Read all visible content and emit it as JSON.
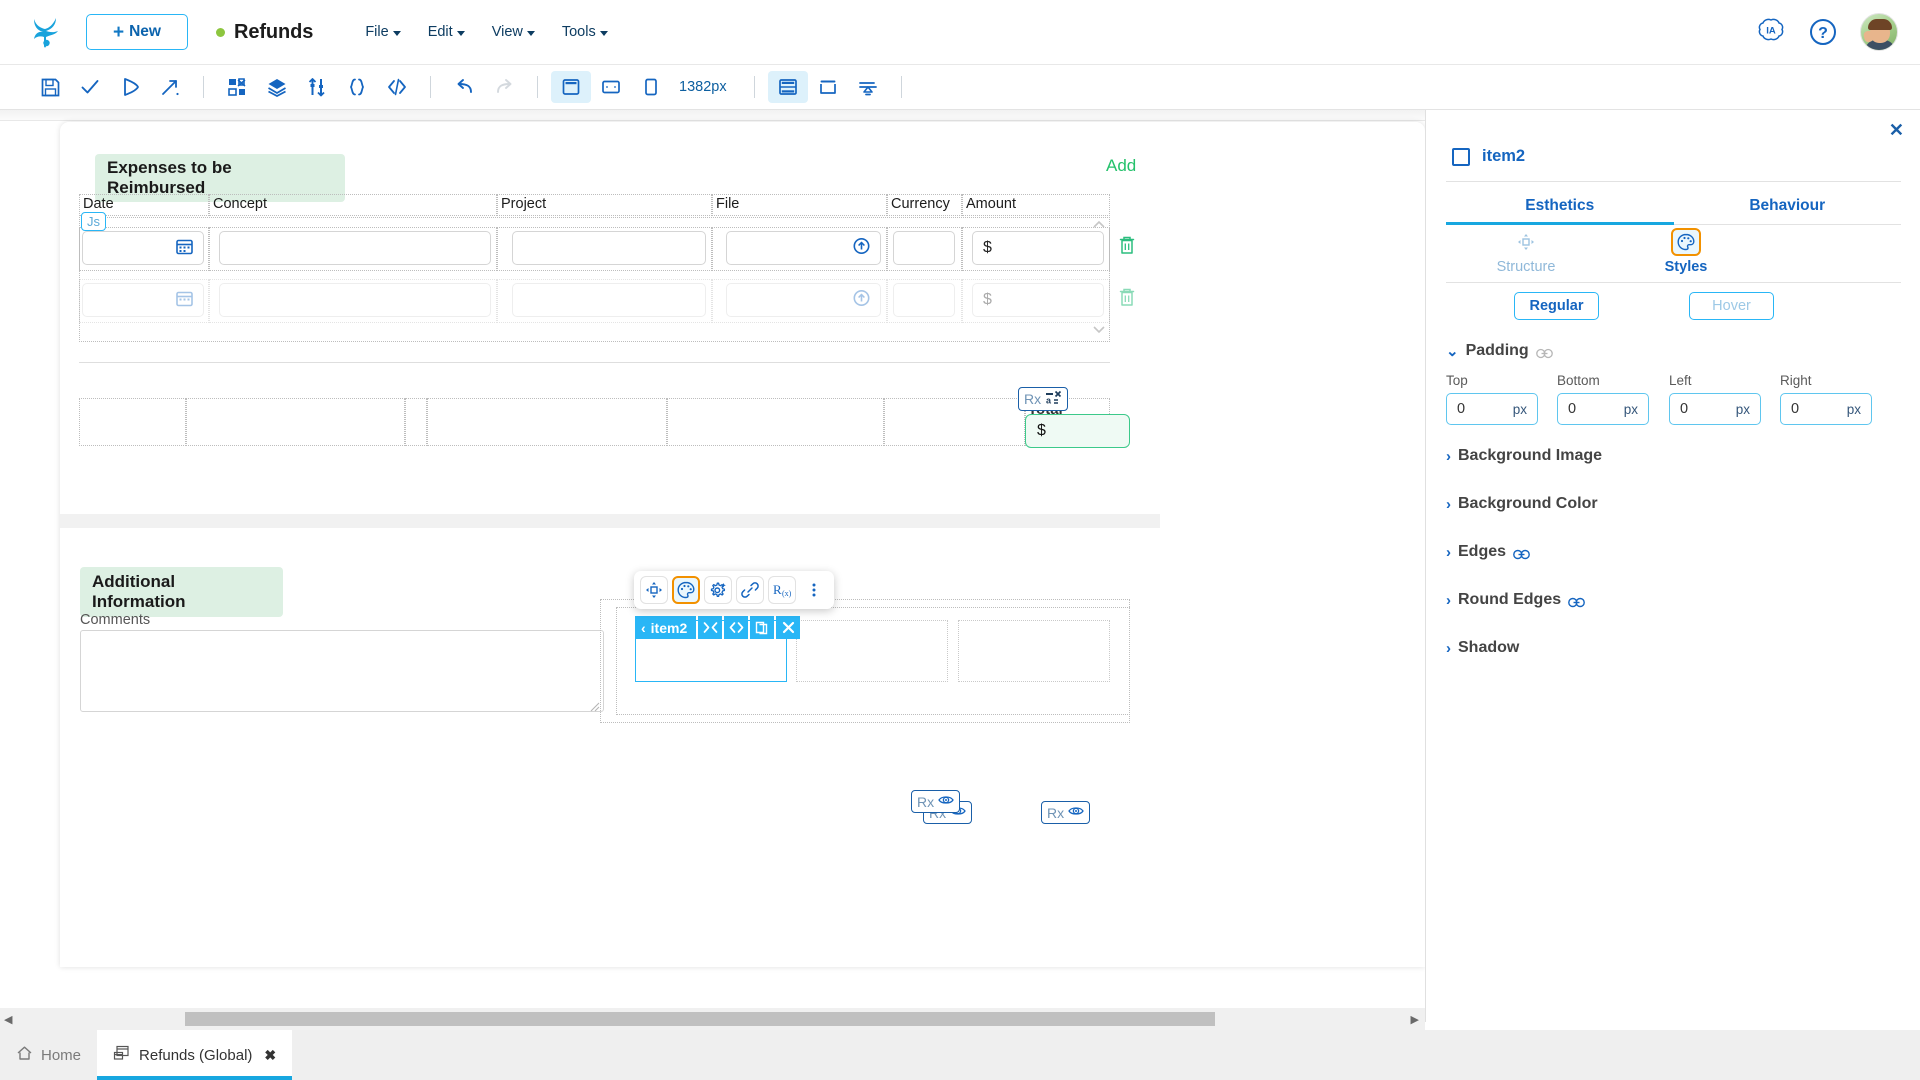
{
  "header": {
    "logo_icon": "frog-logo-icon",
    "new_button": "New",
    "app_title": "Refunds",
    "status_dot_color": "#8dc63f",
    "menus": [
      "File",
      "Edit",
      "View",
      "Tools"
    ],
    "right_icons": [
      {
        "name": "ia-assistant-icon",
        "label": "IA"
      },
      {
        "name": "help-icon",
        "label": "?"
      },
      {
        "name": "user-avatar",
        "label": ""
      }
    ]
  },
  "toolbar": {
    "viewport_size": "1382px",
    "groups": [
      [
        {
          "name": "save-icon",
          "active": false
        },
        {
          "name": "validate-check-icon",
          "active": false
        },
        {
          "name": "run-play-icon",
          "active": false
        },
        {
          "name": "deploy-share-icon",
          "active": false
        }
      ],
      [
        {
          "name": "components-grid-icon",
          "active": false
        },
        {
          "name": "layers-stack-icon",
          "active": false
        },
        {
          "name": "data-model-icon",
          "active": false
        },
        {
          "name": "variables-braces-icon",
          "active": false
        },
        {
          "name": "code-brackets-icon",
          "active": false
        }
      ],
      [
        {
          "name": "undo-icon",
          "active": false
        },
        {
          "name": "redo-icon",
          "active": false,
          "disabled": true
        }
      ],
      [
        {
          "name": "desktop-view-icon",
          "active": true
        },
        {
          "name": "tablet-view-icon",
          "active": false
        },
        {
          "name": "mobile-view-icon",
          "active": false
        }
      ],
      [
        {
          "name": "grid-layout-icon",
          "active": false
        },
        {
          "name": "container-icon",
          "active": false
        },
        {
          "name": "align-icon",
          "active": false
        }
      ]
    ]
  },
  "canvas": {
    "expenses": {
      "title": "Expenses to be Reimbursed",
      "add_link": "Add",
      "columns": [
        "Date",
        "Concept",
        "Project",
        "File",
        "Currency",
        "Amount"
      ],
      "js_badge": "Js",
      "rows": [
        {
          "date": "",
          "concept": "",
          "project": "",
          "file": "",
          "currency": "",
          "amount_symbol": "$",
          "date_icon": "calendar-icon",
          "file_icon": "upload-circle-icon",
          "delete_icon": "trash-icon",
          "faded": false
        },
        {
          "date": "",
          "concept": "",
          "project": "",
          "file": "",
          "currency": "",
          "amount_symbol": "$",
          "date_icon": "calendar-icon",
          "file_icon": "upload-circle-icon",
          "delete_icon": "trash-icon",
          "faded": true
        }
      ]
    },
    "totals": {
      "label": "Total",
      "value_symbol": "$",
      "rx_badge": {
        "label": "Rx",
        "icon": "formula-abc-icon"
      }
    },
    "additional": {
      "title": "Additional Information",
      "comments_label": "Comments",
      "comments_value": ""
    },
    "selection": {
      "element_name": "item2",
      "back_chevron": "‹",
      "chips": [
        {
          "name": "collapse-expand-icon",
          "glyph": "><"
        },
        {
          "name": "code-view-icon",
          "glyph": "<>"
        },
        {
          "name": "duplicate-icon",
          "glyph": "copy"
        },
        {
          "name": "close-selection-icon",
          "glyph": "✕"
        }
      ]
    },
    "float_toolbar": [
      {
        "name": "move-structure-icon",
        "highlighted": false
      },
      {
        "name": "styles-palette-icon",
        "highlighted": true
      },
      {
        "name": "settings-gear-icon",
        "highlighted": false
      },
      {
        "name": "link-chain-icon",
        "highlighted": false
      },
      {
        "name": "formula-rx-icon",
        "highlighted": false
      },
      {
        "name": "more-options-icon",
        "highlighted": false
      }
    ],
    "rx_badges": [
      {
        "label": "Rx",
        "icon": "eye-visibility-icon"
      },
      {
        "label": "Rx",
        "icon": "eye-visibility-icon"
      },
      {
        "label": "Rx",
        "icon": "eye-visibility-icon"
      }
    ]
  },
  "panel": {
    "close_icon": "close-icon",
    "element_name": "item2",
    "tabs": [
      {
        "label": "Esthetics",
        "active": true
      },
      {
        "label": "Behaviour",
        "active": false
      }
    ],
    "sub_tabs": [
      {
        "label": "Structure",
        "icon": "move-structure-icon",
        "active": false
      },
      {
        "label": "Styles",
        "icon": "styles-palette-icon",
        "active": true
      }
    ],
    "state_buttons": [
      {
        "label": "Regular",
        "active": true
      },
      {
        "label": "Hover",
        "active": false
      }
    ],
    "padding": {
      "title": "Padding",
      "linked_icon": "link-chain-icon",
      "expanded": true,
      "fields": [
        {
          "label": "Top",
          "value": "0",
          "unit": "px"
        },
        {
          "label": "Bottom",
          "value": "0",
          "unit": "px"
        },
        {
          "label": "Left",
          "value": "0",
          "unit": "px"
        },
        {
          "label": "Right",
          "value": "0",
          "unit": "px"
        }
      ]
    },
    "sections": [
      {
        "title": "Background Image",
        "expanded": false,
        "has_link": false
      },
      {
        "title": "Background Color",
        "expanded": false,
        "has_link": false
      },
      {
        "title": "Edges",
        "expanded": false,
        "has_link": true
      },
      {
        "title": "Round Edges",
        "expanded": false,
        "has_link": true
      },
      {
        "title": "Shadow",
        "expanded": false,
        "has_link": false
      }
    ]
  },
  "bottom": {
    "scroll_left_arrow": "◀",
    "scroll_right_arrow": "▶",
    "tabs": [
      {
        "label": "Home",
        "icon": "home-icon",
        "active": false,
        "closable": false
      },
      {
        "label": "Refunds (Global)",
        "icon": "app-window-icon",
        "active": true,
        "closable": true,
        "close_glyph": "✖"
      }
    ]
  }
}
